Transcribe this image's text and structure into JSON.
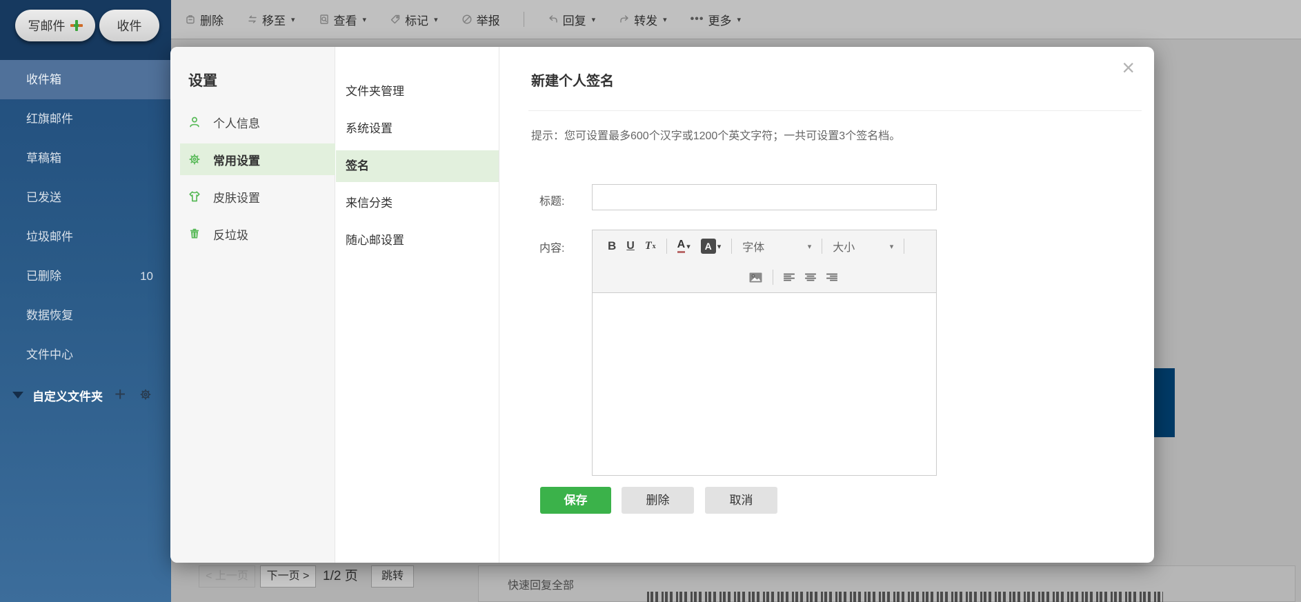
{
  "colors": {
    "accent_green": "#3bb24a",
    "selected_green_bg": "#e2f0dd",
    "sidebar_blue": "#2a5a87",
    "sidebar_header_blue": "#16395f",
    "sidebar_selected_blue": "#50719a",
    "dim_overlay_gray": "#b1b1b1",
    "hidden_button_blue": "#003a66"
  },
  "icons": {
    "caret": "▾",
    "more_dots": "•••",
    "plus": "+"
  },
  "sidebar": {
    "compose_label": "写邮件",
    "receive_label": "收件",
    "items": [
      {
        "label": "收件箱"
      },
      {
        "label": "红旗邮件"
      },
      {
        "label": "草稿箱"
      },
      {
        "label": "已发送"
      },
      {
        "label": "垃圾邮件"
      },
      {
        "label": "已删除",
        "count": "10"
      },
      {
        "label": "数据恢复"
      },
      {
        "label": "文件中心"
      }
    ],
    "custom_folder_label": "自定义文件夹"
  },
  "toolbar": {
    "delete": "删除",
    "move": "移至",
    "view": "查看",
    "mark": "标记",
    "report": "举报",
    "reply": "回复",
    "forward": "转发",
    "more": "更多"
  },
  "settings_nav": {
    "title": "设置",
    "items": [
      {
        "label": "个人信息"
      },
      {
        "label": "常用设置"
      },
      {
        "label": "皮肤设置"
      },
      {
        "label": "反垃圾"
      }
    ]
  },
  "settings_subnav": {
    "items": [
      {
        "label": "文件夹管理"
      },
      {
        "label": "系统设置"
      },
      {
        "label": "签名"
      },
      {
        "label": "来信分类"
      },
      {
        "label": "随心邮设置"
      }
    ]
  },
  "signature": {
    "title": "新建个人签名",
    "close_icon": "×",
    "tip": "提示：您可设置最多600个汉字或1200个英文字符；一共可设置3个签名档。",
    "title_label": "标题:",
    "content_label": "内容:",
    "title_value": "",
    "editor": {
      "bold": "B",
      "underline": "U",
      "clear_t": "T",
      "clear_x": "x",
      "color_a": "A",
      "bg_a": "A",
      "font": "字体",
      "size": "大小"
    },
    "save": "保存",
    "delete": "删除",
    "cancel": "取消"
  },
  "pagination": {
    "prev": "< 上一页",
    "next": "下一页 >",
    "page": "1/2 页",
    "jump": "跳转"
  },
  "quick_reply": "快速回复全部"
}
